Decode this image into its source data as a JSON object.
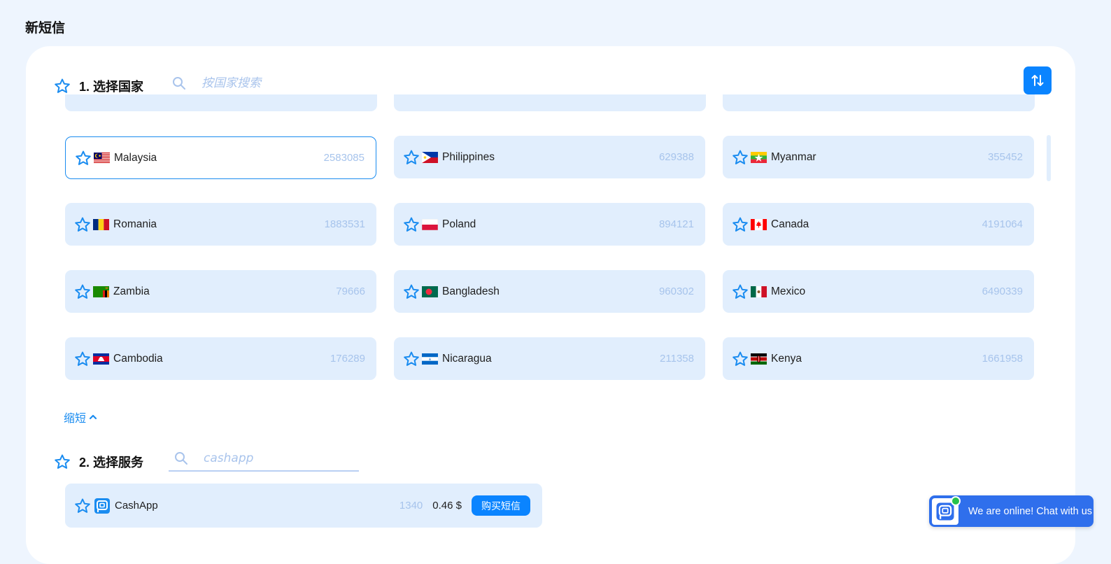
{
  "page": {
    "title": "新短信"
  },
  "step1": {
    "title": "1. 选择国家",
    "search_placeholder": "按国家搜索",
    "collapse_label": "缩短"
  },
  "countries": [
    {
      "name": "Malaysia",
      "count": "2583085",
      "flag": "malaysia-flag",
      "selected": true
    },
    {
      "name": "Philippines",
      "count": "629388",
      "flag": "philippines-flag"
    },
    {
      "name": "Myanmar",
      "count": "355452",
      "flag": "myanmar-flag"
    },
    {
      "name": "Romania",
      "count": "1883531",
      "flag": "romania-flag"
    },
    {
      "name": "Poland",
      "count": "894121",
      "flag": "poland-flag"
    },
    {
      "name": "Canada",
      "count": "4191064",
      "flag": "canada-flag"
    },
    {
      "name": "Zambia",
      "count": "79666",
      "flag": "zambia-flag"
    },
    {
      "name": "Bangladesh",
      "count": "960302",
      "flag": "bangladesh-flag"
    },
    {
      "name": "Mexico",
      "count": "6490339",
      "flag": "mexico-flag"
    },
    {
      "name": "Cambodia",
      "count": "176289",
      "flag": "cambodia-flag"
    },
    {
      "name": "Nicaragua",
      "count": "211358",
      "flag": "nicaragua-flag"
    },
    {
      "name": "Kenya",
      "count": "1661958",
      "flag": "kenya-flag"
    }
  ],
  "step2": {
    "title": "2. 选择服务",
    "search_value": "cashapp"
  },
  "service": {
    "name": "CashApp",
    "count": "1340",
    "price": "0.46 $",
    "buy_label": "购买短信"
  },
  "chat": {
    "label": "We are online! Chat with us"
  },
  "colors": {
    "accent": "#0a84ff",
    "tile": "#e1eefd",
    "count": "#a7c4ec",
    "background": "#eef5fe"
  }
}
